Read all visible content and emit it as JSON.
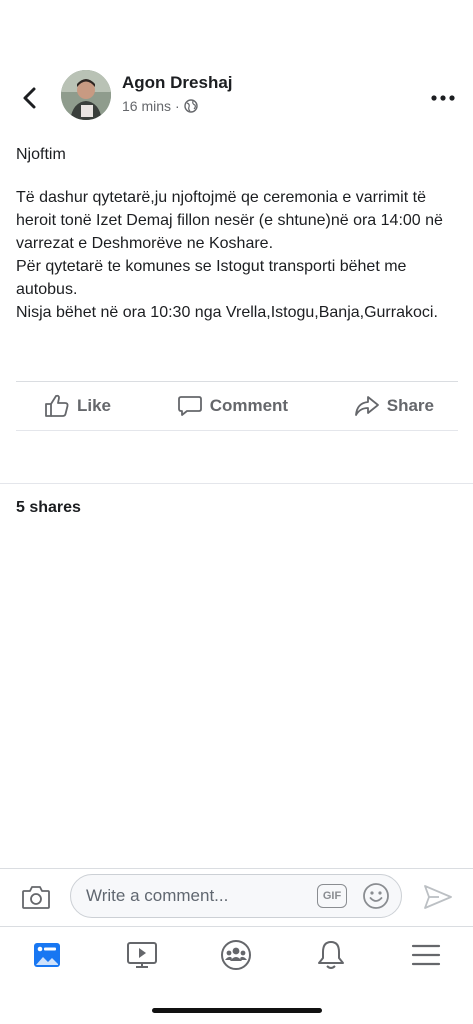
{
  "post": {
    "author": "Agon Dreshaj",
    "time": "16 mins",
    "separator": "·",
    "audience_icon": "globe-icon",
    "title": "Njoftim",
    "body_lines": [
      "Të dashur qytetarë,ju njoftojmë qe ceremonia e varrimit të heroit tonë Izet Demaj fillon nesër (e shtune)në ora 14:00 në varrezat e Deshmorëve ne Koshare.",
      "Për qytetarë te komunes se Istogut transporti bëhet me autobus.",
      "Nisja bëhet në ora 10:30 nga Vrella,Istogu,Banja,Gurrakoci."
    ]
  },
  "actions": {
    "like": "Like",
    "comment": "Comment",
    "share": "Share"
  },
  "shares_text": "5 shares",
  "composer": {
    "placeholder": "Write a comment...",
    "gif": "GIF"
  },
  "nav": {
    "items": [
      "news-feed-icon",
      "watch-icon",
      "groups-icon",
      "notifications-icon",
      "menu-icon"
    ],
    "active_color": "#1877f2"
  },
  "colors": {
    "accent": "#1877f2",
    "muted": "#65676b"
  }
}
